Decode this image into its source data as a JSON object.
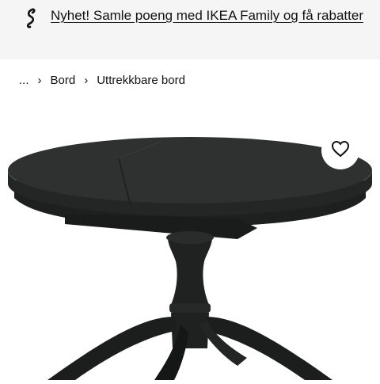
{
  "promo": {
    "icon": "family-link-icon",
    "text": "Nyhet! Samle poeng med IKEA Family og få rabatter"
  },
  "breadcrumb": {
    "ellipsis": "...",
    "items": [
      "Bord",
      "Uttrekkbare bord"
    ]
  },
  "product": {
    "image_icon": "round-extendable-table",
    "favourite_icon": "heart-icon"
  },
  "colors": {
    "banner_bg": "#f5f5f5",
    "table": "#2b2d2c"
  }
}
